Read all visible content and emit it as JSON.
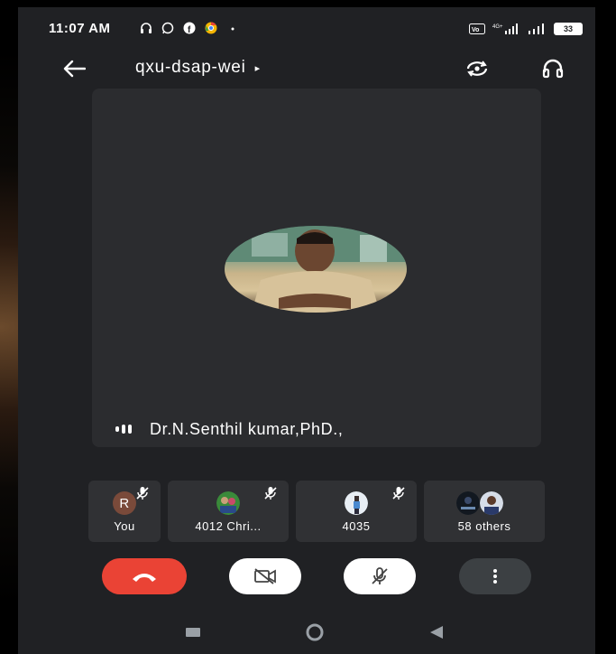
{
  "status_bar": {
    "time": "11:07 AM",
    "battery": "33",
    "icons": [
      "headphones-icon",
      "whatsapp-icon",
      "facebook-icon",
      "chrome-icon",
      "dot-icon",
      "volte-icon",
      "signal-4g-icon",
      "signal-icon",
      "battery-icon"
    ]
  },
  "header": {
    "meeting_code": "qxu-dsap-wei",
    "caret": "▸"
  },
  "main": {
    "speaker_name": "Dr.N.Senthil kumar,PhD.,"
  },
  "participants": [
    {
      "name": "You",
      "initial": "R",
      "muted": true
    },
    {
      "name": "4012 Chri...",
      "muted": true
    },
    {
      "name": "4035",
      "muted": true
    },
    {
      "name": "58 others",
      "muted": false
    }
  ],
  "controls": {
    "end_call_color": "#ea4335",
    "video_state": "off",
    "mic_state": "off"
  },
  "colors": {
    "background": "#202124",
    "tile": "#2b2c2f",
    "participant_tile": "#303134",
    "end_call": "#ea4335"
  }
}
